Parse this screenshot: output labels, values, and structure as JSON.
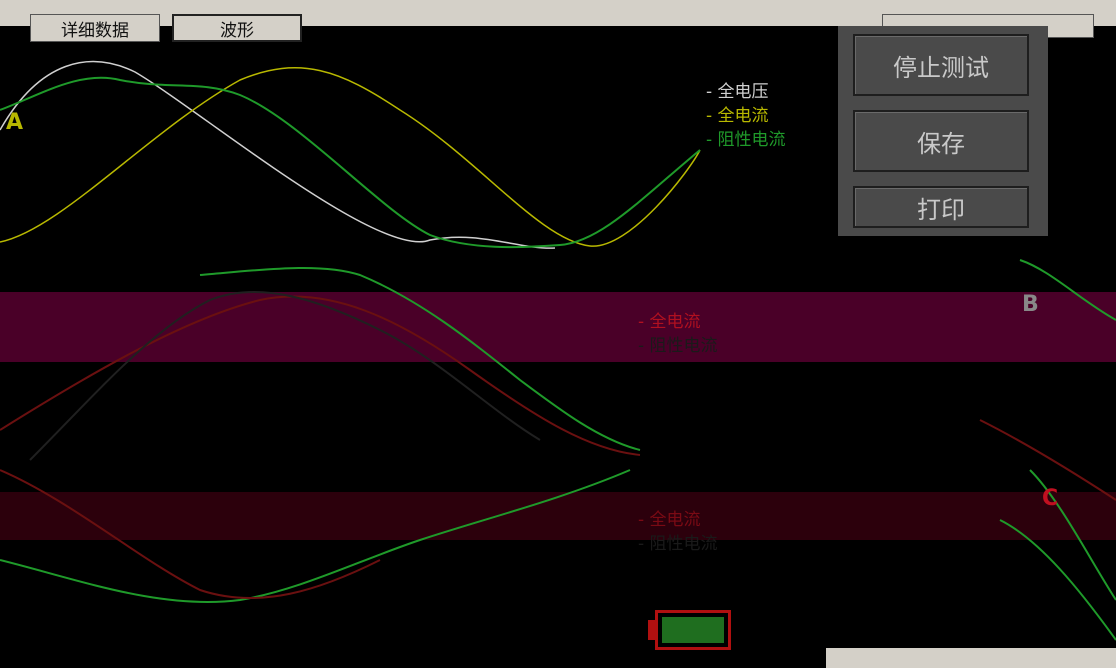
{
  "tabs": [
    {
      "label": "详细数据"
    },
    {
      "label": "波形"
    }
  ],
  "buttons": {
    "stop": "停止测试",
    "save": "保存",
    "print": "打印"
  },
  "legend_a": [
    "全电压",
    "全电流",
    "阻性电流"
  ],
  "legend_b": [
    "全电流",
    "阻性电流"
  ],
  "legend_c": [
    "全电流",
    "阻性电流"
  ],
  "phase_labels": {
    "a": "A",
    "b": "B",
    "c": "C"
  },
  "colors": {
    "voltage": "#d0d0d0",
    "current": "#b8b800",
    "resistive": "#1f9a2a",
    "b_band": "#5a0030",
    "c_band": "#3a0010",
    "battery": "#1f6e1f"
  },
  "battery_level": 1.0
}
